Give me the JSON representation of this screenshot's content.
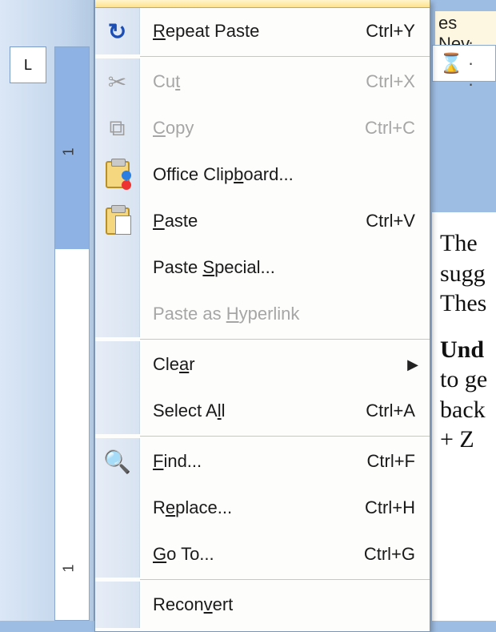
{
  "background_fragments": {
    "font_dropdown_truncated": "es Nev",
    "document_lines": [
      "The ",
      "sugg",
      "Thes",
      "Und",
      "to ge",
      "back",
      "+ Z"
    ],
    "vruler_mark": "1",
    "vruler_mark2": "1",
    "tab_selector_label": "L"
  },
  "menu": {
    "items": [
      {
        "id": "repeat",
        "icon": "repeat-icon",
        "label_pre": "",
        "mn": "R",
        "label_post": "epeat Paste",
        "shortcut": "Ctrl+Y",
        "enabled": true,
        "submenu": false
      },
      {
        "sep": true
      },
      {
        "id": "cut",
        "icon": "cut-icon",
        "label_pre": "Cu",
        "mn": "t",
        "label_post": "",
        "shortcut": "Ctrl+X",
        "enabled": false,
        "submenu": false
      },
      {
        "id": "copy",
        "icon": "copy-icon",
        "label_pre": "",
        "mn": "C",
        "label_post": "opy",
        "shortcut": "Ctrl+C",
        "enabled": false,
        "submenu": false
      },
      {
        "id": "clipboard",
        "icon": "clipboard-icon",
        "label_pre": "Office Clip",
        "mn": "b",
        "label_post": "oard...",
        "shortcut": "",
        "enabled": true,
        "submenu": false
      },
      {
        "id": "paste",
        "icon": "paste-icon",
        "label_pre": "",
        "mn": "P",
        "label_post": "aste",
        "shortcut": "Ctrl+V",
        "enabled": true,
        "submenu": false
      },
      {
        "id": "pspecial",
        "icon": "",
        "label_pre": "Paste ",
        "mn": "S",
        "label_post": "pecial...",
        "shortcut": "",
        "enabled": true,
        "submenu": false
      },
      {
        "id": "phyper",
        "icon": "",
        "label_pre": "Paste as ",
        "mn": "H",
        "label_post": "yperlink",
        "shortcut": "",
        "enabled": false,
        "submenu": false
      },
      {
        "sep": true
      },
      {
        "id": "clear",
        "icon": "",
        "label_pre": "Cle",
        "mn": "a",
        "label_post": "r",
        "shortcut": "",
        "enabled": true,
        "submenu": true
      },
      {
        "id": "selall",
        "icon": "",
        "label_pre": "Select A",
        "mn": "l",
        "label_post": "l",
        "shortcut": "Ctrl+A",
        "enabled": true,
        "submenu": false
      },
      {
        "sep": true
      },
      {
        "id": "find",
        "icon": "find-icon",
        "label_pre": "",
        "mn": "F",
        "label_post": "ind...",
        "shortcut": "Ctrl+F",
        "enabled": true,
        "submenu": false
      },
      {
        "id": "replace",
        "icon": "",
        "label_pre": "R",
        "mn": "e",
        "label_post": "place...",
        "shortcut": "Ctrl+H",
        "enabled": true,
        "submenu": false
      },
      {
        "id": "goto",
        "icon": "",
        "label_pre": "",
        "mn": "G",
        "label_post": "o To...",
        "shortcut": "Ctrl+G",
        "enabled": true,
        "submenu": false
      },
      {
        "sep": true
      },
      {
        "id": "reconv",
        "icon": "",
        "label_pre": "Recon",
        "mn": "v",
        "label_post": "ert",
        "shortcut": "",
        "enabled": true,
        "submenu": false
      }
    ]
  }
}
